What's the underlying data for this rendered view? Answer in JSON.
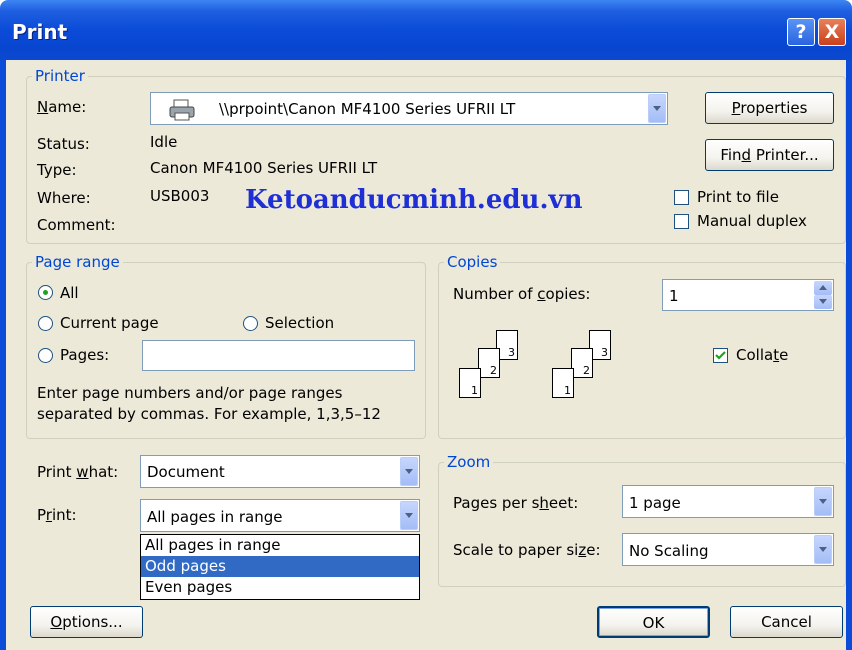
{
  "window": {
    "title": "Print",
    "help_glyph": "?",
    "close_glyph": "X"
  },
  "printer": {
    "group_label": "Printer",
    "name_label": "Name:",
    "name_value": "\\\\prpoint\\Canon MF4100 Series UFRII LT",
    "status_label": "Status:",
    "status_value": "Idle",
    "type_label": "Type:",
    "type_value": "Canon MF4100 Series UFRII LT",
    "where_label": "Where:",
    "where_value": "USB003",
    "comment_label": "Comment:",
    "properties_button": "Properties",
    "find_printer_button": "Find Printer...",
    "print_to_file_label": "Print to file",
    "print_to_file_checked": false,
    "manual_duplex_label": "Manual duplex",
    "manual_duplex_checked": false
  },
  "watermark": "Ketoanducminh.edu.vn",
  "page_range": {
    "group_label": "Page range",
    "all_label": "All",
    "current_page_label": "Current page",
    "selection_label": "Selection",
    "pages_label": "Pages:",
    "pages_value": "",
    "selected": "All",
    "hint": "Enter page numbers and/or page ranges separated by commas.  For example, 1,3,5–12",
    "hint_line1": "Enter page numbers and/or page ranges",
    "hint_line2": "separated by commas.  For example, 1,3,5–12"
  },
  "copies": {
    "group_label": "Copies",
    "number_label": "Number of copies:",
    "number_value": "1",
    "collate_label": "Collate",
    "collate_checked": true,
    "page_numbers": [
      "3",
      "2",
      "1"
    ]
  },
  "print_what": {
    "label": "Print what:",
    "value": "Document"
  },
  "print": {
    "label": "Print:",
    "value": "All pages in range",
    "options": [
      "All pages in range",
      "Odd pages",
      "Even pages"
    ],
    "highlighted": "Odd pages"
  },
  "zoom": {
    "group_label": "Zoom",
    "pages_per_sheet_label": "Pages per sheet:",
    "pages_per_sheet_value": "1 page",
    "scale_label": "Scale to paper size:",
    "scale_value": "No Scaling"
  },
  "buttons": {
    "options": "Options...",
    "ok": "OK",
    "cancel": "Cancel"
  },
  "colors": {
    "title_bar": "#0a4bd8",
    "dialog_bg": "#ece9d8",
    "group_label": "#0046d5",
    "highlight": "#316ac5",
    "watermark": "#1f2fd6"
  }
}
